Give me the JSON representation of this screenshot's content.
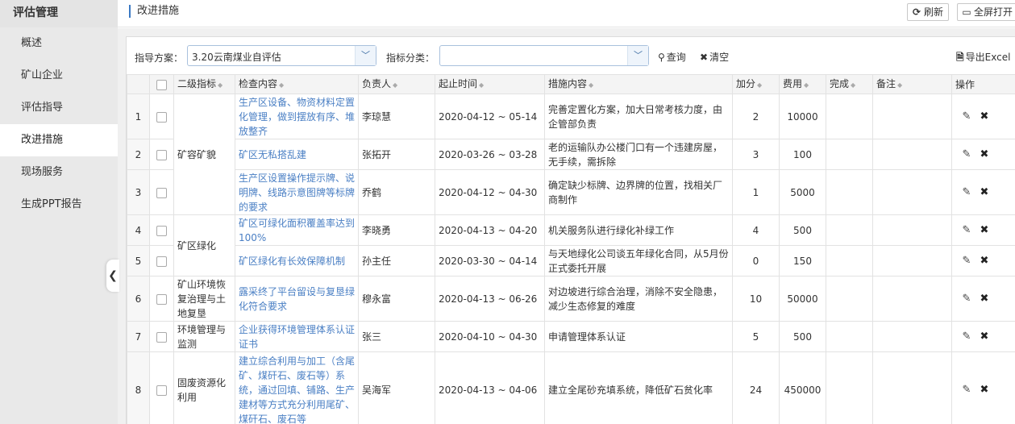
{
  "sidebar": {
    "title": "评估管理",
    "items": [
      {
        "label": "概述"
      },
      {
        "label": "矿山企业"
      },
      {
        "label": "评估指导"
      },
      {
        "label": "改进措施"
      },
      {
        "label": "现场服务"
      },
      {
        "label": "生成PPT报告"
      }
    ],
    "active_index": 3
  },
  "header": {
    "title": "改进措施",
    "refresh_label": "刷新",
    "fullscreen_label": "全屏打开"
  },
  "filters": {
    "plan_label": "指导方案：",
    "plan_value": "3.20云南煤业自评估",
    "category_label": "指标分类：",
    "category_value": "",
    "query_label": "查询",
    "clear_label": "清空",
    "export_label": "导出Excel"
  },
  "table": {
    "headers": {
      "level2": "二级指标",
      "content": "检查内容",
      "person": "负责人",
      "period": "起止时间",
      "measure": "措施内容",
      "bonus": "加分",
      "cost": "费用",
      "done": "完成",
      "note": "备注",
      "ops": "操作"
    },
    "groups": [
      {
        "label": "矿容矿貌"
      },
      {
        "label": "矿区绿化"
      },
      {
        "label": "矿山环境恢复治理与土地复垦"
      },
      {
        "label": "环境管理与监测"
      },
      {
        "label": "固废资源化利用"
      }
    ],
    "rows": [
      {
        "no": "1",
        "content": "生产区设备、物资材料定置化管理，做到摆放有序、堆放整齐",
        "person": "李琼慧",
        "period": "2020-04-12 ~ 05-14",
        "measure": "完善定置化方案，加大日常考核力度，由企管部负责",
        "bonus": "2",
        "cost": "10000",
        "done": "",
        "note": ""
      },
      {
        "no": "2",
        "content": "矿区无私搭乱建",
        "person": "张拓开",
        "period": "2020-03-26 ~ 03-28",
        "measure": "老的运输队办公楼门口有一个违建房屋，无手续，需拆除",
        "bonus": "3",
        "cost": "100",
        "done": "",
        "note": ""
      },
      {
        "no": "3",
        "content": "生产区设置操作提示牌、说明牌、线路示意图牌等标牌的要求",
        "person": "乔鹤",
        "period": "2020-04-12 ~ 04-30",
        "measure": "确定缺少标牌、边界牌的位置，找相关厂商制作",
        "bonus": "1",
        "cost": "5000",
        "done": "",
        "note": ""
      },
      {
        "no": "4",
        "content": "矿区可绿化面积覆盖率达到100%",
        "person": "李晓勇",
        "period": "2020-04-13 ~ 04-20",
        "measure": "机关服务队进行绿化补绿工作",
        "bonus": "4",
        "cost": "500",
        "done": "",
        "note": ""
      },
      {
        "no": "5",
        "content": "矿区绿化有长效保障机制",
        "person": "孙主任",
        "period": "2020-03-30 ~ 04-14",
        "measure": "与天地绿化公司谈五年绿化合同，从5月份正式委托开展",
        "bonus": "0",
        "cost": "150",
        "done": "",
        "note": ""
      },
      {
        "no": "6",
        "content": "露采终了平台留设与复垦绿化符合要求",
        "person": "穆永富",
        "period": "2020-04-13 ~ 06-26",
        "measure": "对边坡进行综合治理，消除不安全隐患，减少生态修复的难度",
        "bonus": "10",
        "cost": "50000",
        "done": "",
        "note": ""
      },
      {
        "no": "7",
        "content": "企业获得环境管理体系认证证书",
        "person": "张三",
        "period": "2020-04-10 ~ 04-30",
        "measure": "申请管理体系认证",
        "bonus": "5",
        "cost": "500",
        "done": "",
        "note": ""
      },
      {
        "no": "8",
        "content": "建立综合利用与加工（含尾矿、煤矸石、废石等）系统，通过回填、铺路、生产建材等方式充分利用尾矿、煤矸石、废石等",
        "person": "吴海军",
        "period": "2020-04-13 ~ 04-06",
        "measure": "建立全尾砂充填系统，降低矿石贫化率",
        "bonus": "24",
        "cost": "450000",
        "done": "",
        "note": ""
      }
    ]
  },
  "icons": {
    "refresh": "refresh-icon",
    "fullscreen": "fullscreen-icon",
    "search": "search-icon",
    "clear": "close-icon",
    "export": "excel-icon",
    "edit": "edit-icon",
    "delete": "delete-icon",
    "collapse": "chevron-left-icon"
  },
  "colors": {
    "accent": "#3b79c4",
    "link": "#4a7fc4",
    "sidebar_bg": "#e9e9e9"
  }
}
